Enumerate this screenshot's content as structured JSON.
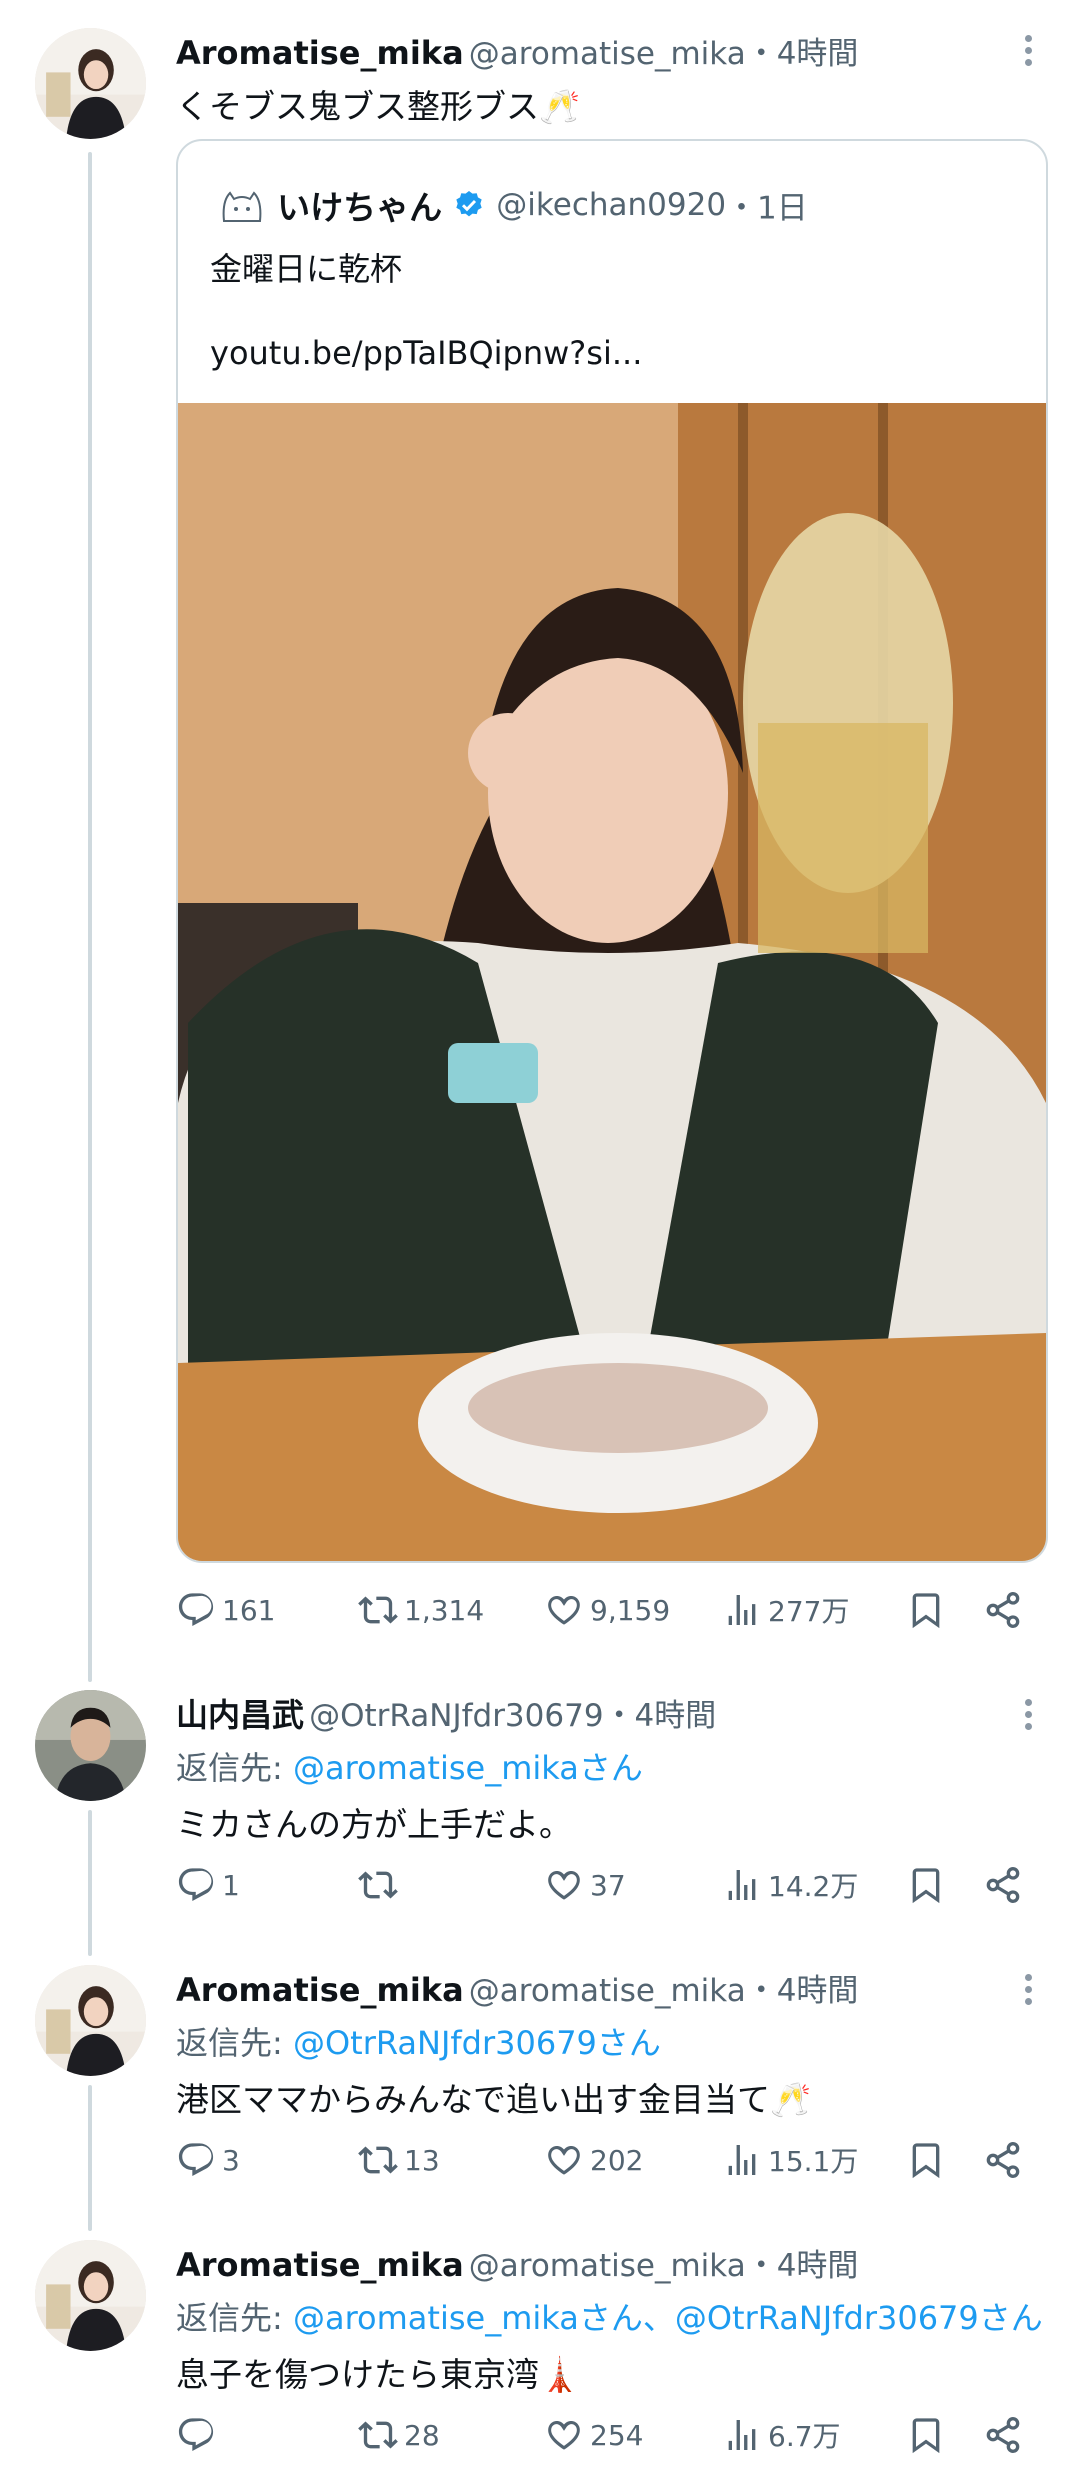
{
  "colors": {
    "link": "#1d9bf0",
    "muted": "#536471",
    "text": "#0f1419",
    "verified": "#1d9bf0"
  },
  "tweets": [
    {
      "name": "Aromatise_mika",
      "handle": "@aromatise_mika",
      "time": "・4時間",
      "text": "くそブス鬼ブス整形ブス🥂",
      "quote": {
        "name": "いけちゃん",
        "handle": "@ikechan0920",
        "time": "・1日",
        "text": "金曜日に乾杯",
        "link": "youtu.be/ppTaIBQipnw?si..."
      },
      "stats": {
        "replies": "161",
        "retweets": "1,314",
        "likes": "9,159",
        "views": "277万"
      }
    },
    {
      "name": "山内昌武",
      "handle": "@OtrRaNJfdr30679",
      "time": "・4時間",
      "reply_prefix": "返信先: ",
      "reply_to": "@aromatise_mikaさん",
      "text": "ミカさんの方が上手だよ。",
      "stats": {
        "replies": "1",
        "retweets": "",
        "likes": "37",
        "views": "14.2万"
      }
    },
    {
      "name": "Aromatise_mika",
      "handle": "@aromatise_mika",
      "time": "・4時間",
      "reply_prefix": "返信先: ",
      "reply_to": "@OtrRaNJfdr30679さん",
      "text": "港区ママからみんなで追い出す金目当て🥂",
      "stats": {
        "replies": "3",
        "retweets": "13",
        "likes": "202",
        "views": "15.1万"
      }
    },
    {
      "name": "Aromatise_mika",
      "handle": "@aromatise_mika",
      "time": "・4時間",
      "reply_prefix": "返信先: ",
      "reply_to": "@aromatise_mikaさん、@OtrRaNJfdr30679さん",
      "text": "息子を傷つけたら東京湾🗼",
      "stats": {
        "replies": "",
        "retweets": "28",
        "likes": "254",
        "views": "6.7万"
      }
    }
  ]
}
